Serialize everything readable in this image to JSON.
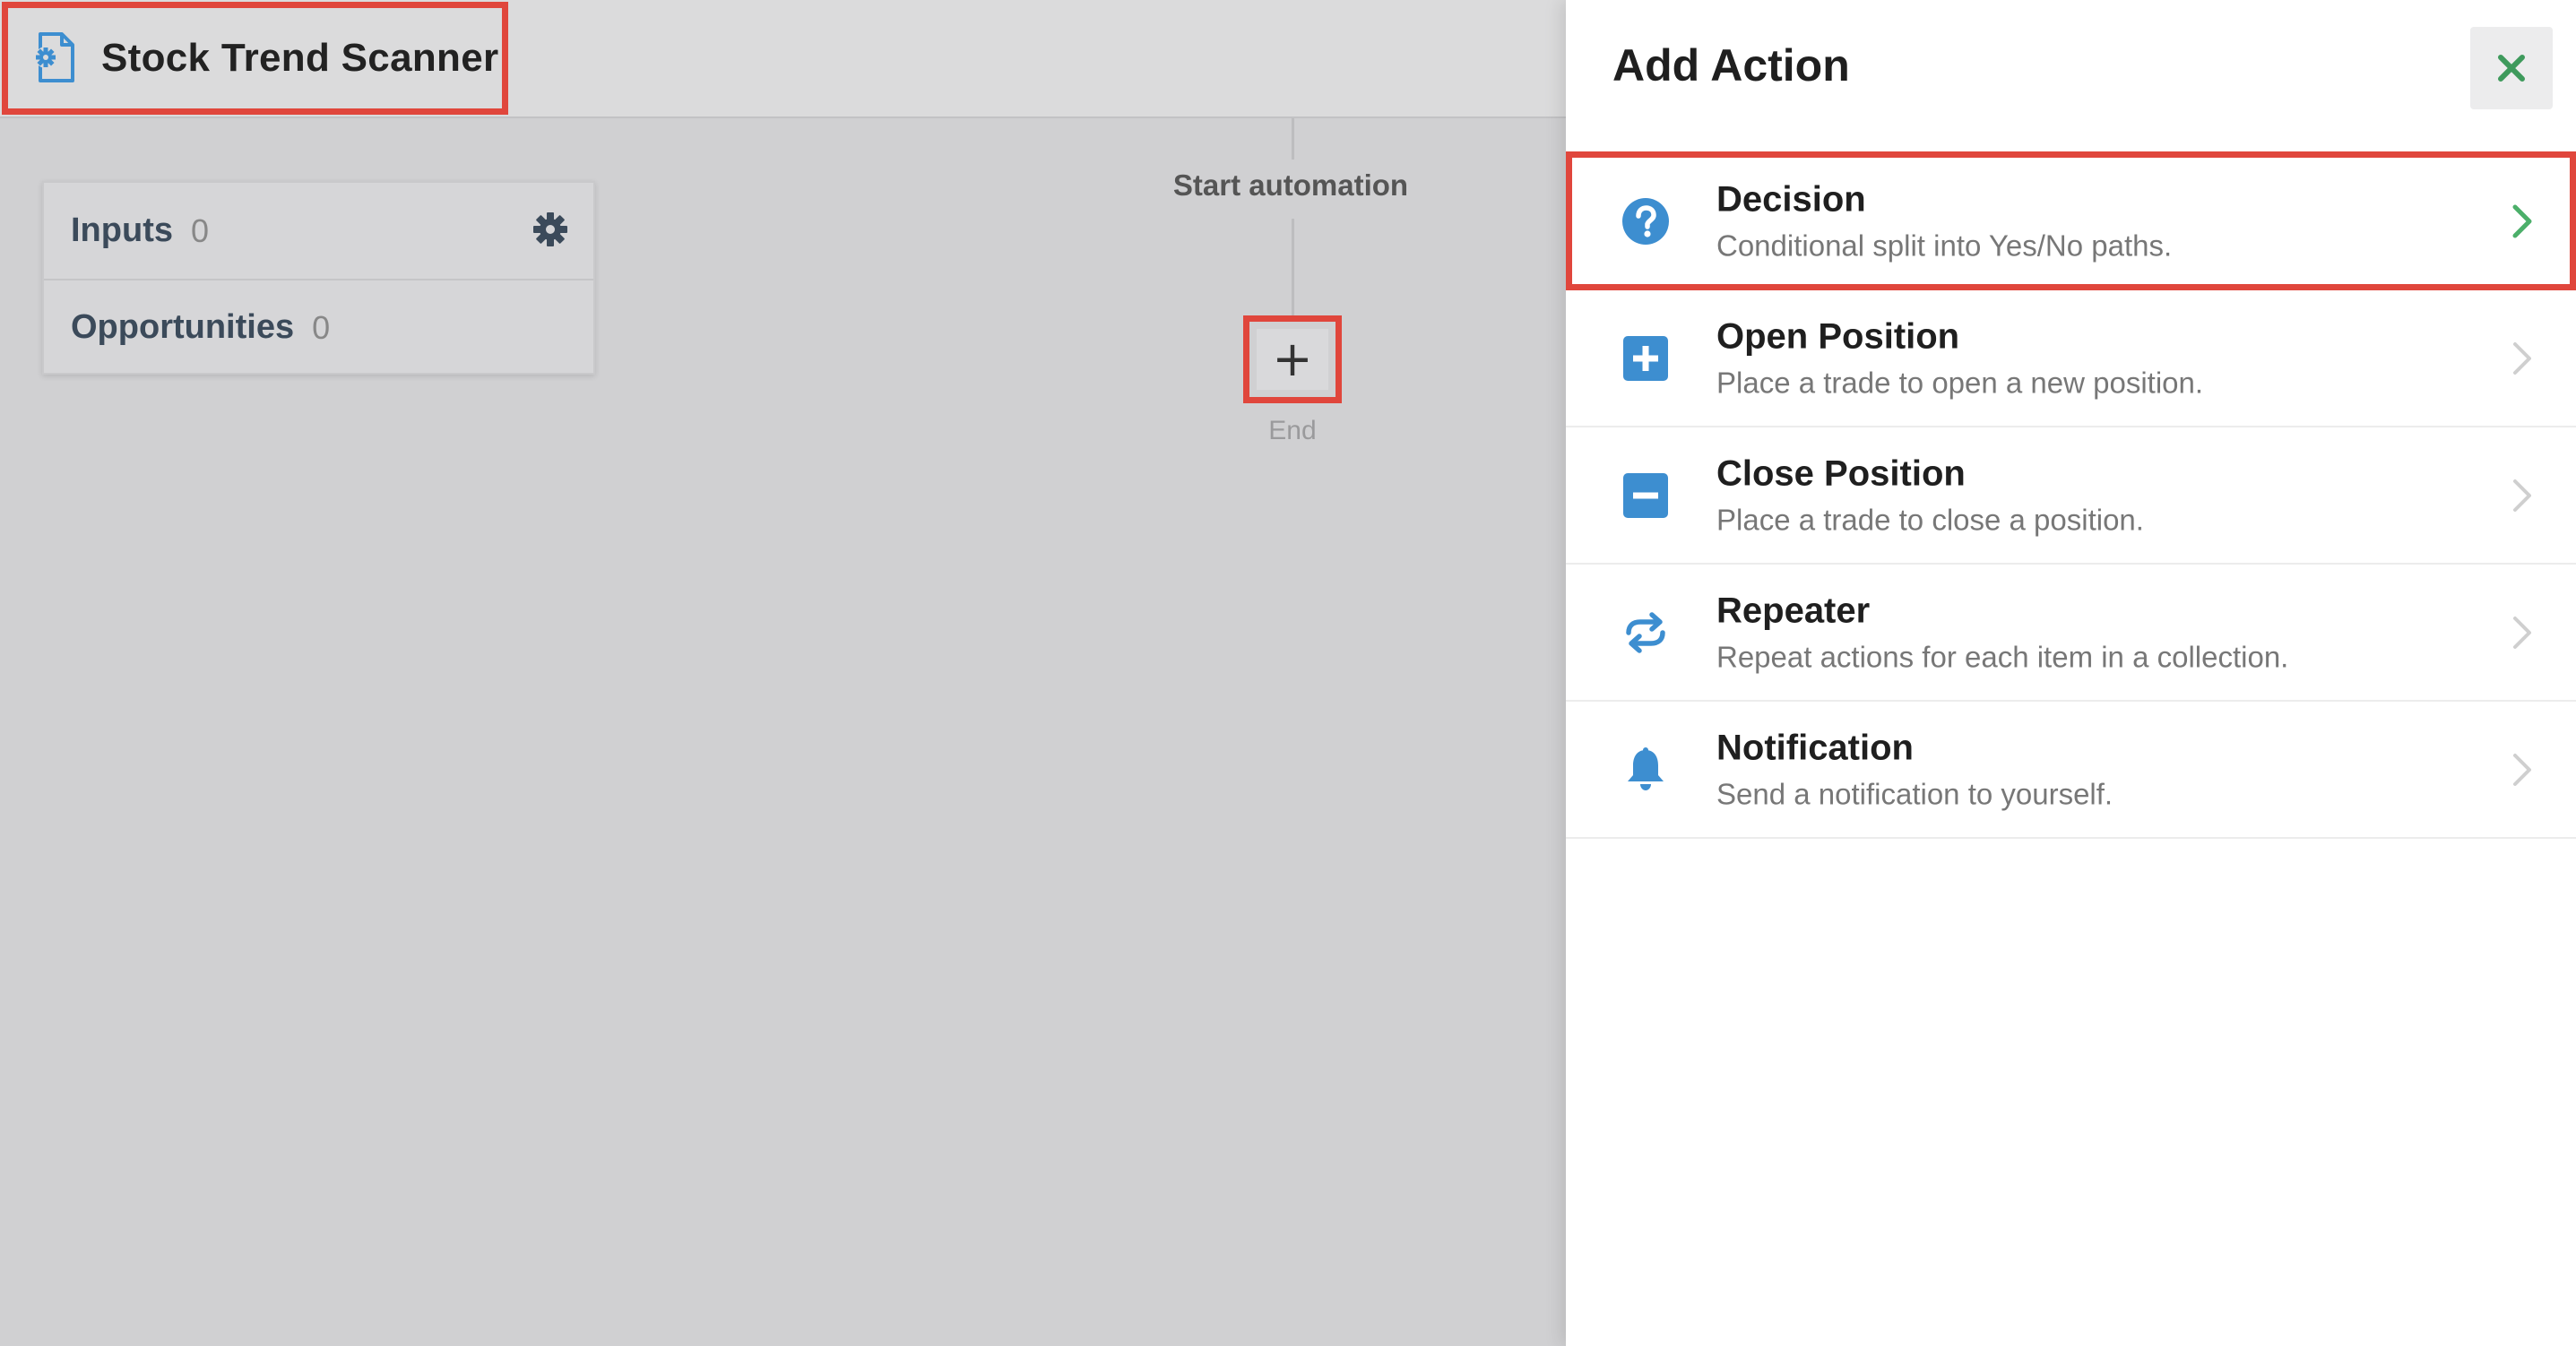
{
  "app": {
    "title": "Stock Trend Scanner",
    "icon": "gear-document-icon"
  },
  "sidebar_card": {
    "inputs_label": "Inputs",
    "inputs_count": "0",
    "opportunities_label": "Opportunities",
    "opportunities_count": "0",
    "settings_icon": "gear-icon"
  },
  "flow": {
    "start_label": "Start automation",
    "add_label": "+",
    "end_label": "End"
  },
  "panel": {
    "title": "Add Action",
    "close_icon": "close-icon",
    "actions": [
      {
        "name": "Decision",
        "desc": "Conditional split into Yes/No paths.",
        "icon": "question-circle-icon"
      },
      {
        "name": "Open Position",
        "desc": "Place a trade to open a new position.",
        "icon": "plus-square-icon"
      },
      {
        "name": "Close Position",
        "desc": "Place a trade to close a position.",
        "icon": "minus-square-icon"
      },
      {
        "name": "Repeater",
        "desc": "Repeat actions for each item in a collection.",
        "icon": "repeat-icon"
      },
      {
        "name": "Notification",
        "desc": "Send a notification to yourself.",
        "icon": "bell-icon"
      }
    ]
  },
  "colors": {
    "accent_blue": "#3d8ed0",
    "highlight_red": "#e0463c",
    "chevron_green": "#4caf6a",
    "close_green": "#3e9a5c"
  }
}
